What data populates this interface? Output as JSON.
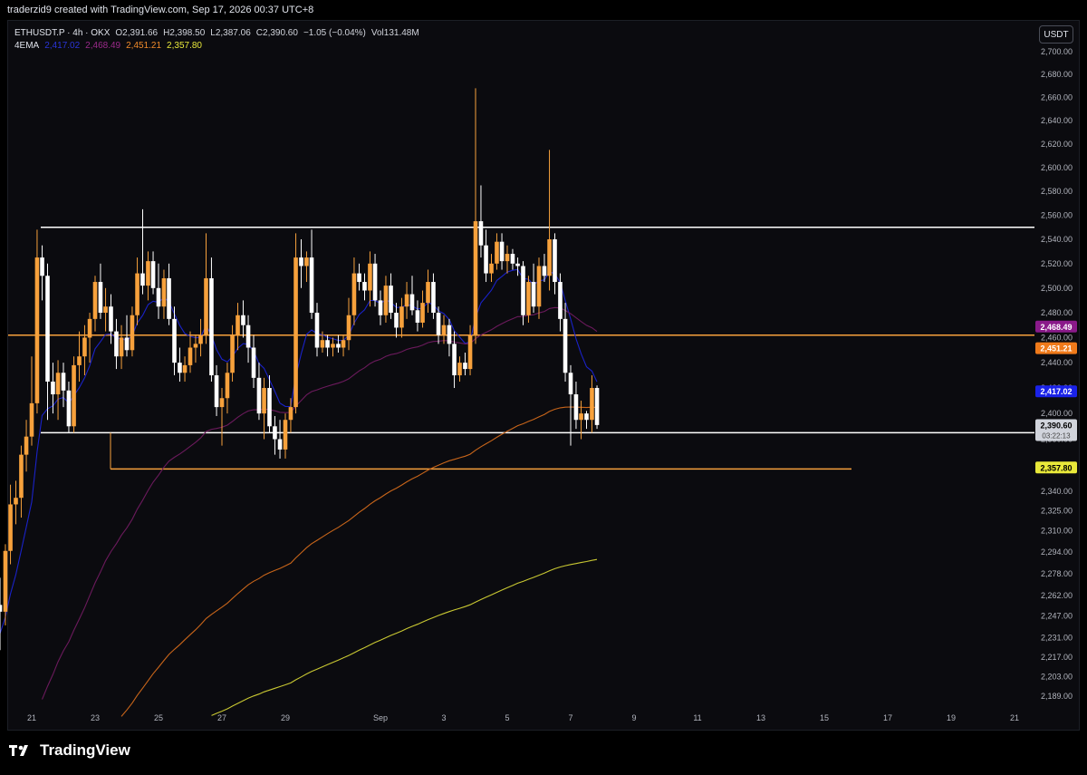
{
  "header": {
    "attribution": "traderzid9 created with TradingView.com, Sep 17, 2026 00:37 UTC+8"
  },
  "legend": {
    "symbol": "ETHUSDT.P · 4h · OKX",
    "open": "O2,391.66",
    "high": "H2,398.50",
    "low": "L2,387.06",
    "close": "C2,390.60",
    "change": "−1.05 (−0.04%)",
    "volume": "Vol131.48M",
    "ema_name": "4EMA",
    "ema_values": [
      "2,417.02",
      "2,468.49",
      "2,451.21",
      "2,357.80"
    ]
  },
  "currency_button": "USDT",
  "footer": {
    "logo_text": "TradingView"
  },
  "colors": {
    "bull": "#f7a13c",
    "bear": "#ffffff",
    "ema1": "#1a22c8",
    "ema2": "#6b1a5c",
    "ema3": "#c8651a",
    "ema4": "#c9c832",
    "price_label_bg": "#d1d4dc",
    "countdown": "03:22:13"
  },
  "chart_data": {
    "type": "candlestick",
    "title": "ETHUSDT.P · 4h · OKX",
    "x_ticks": [
      {
        "label": "21",
        "x": 21
      },
      {
        "label": "23",
        "x": 23
      },
      {
        "label": "25",
        "x": 25
      },
      {
        "label": "27",
        "x": 27
      },
      {
        "label": "29",
        "x": 29
      },
      {
        "label": "Sep",
        "x": 32
      },
      {
        "label": "3",
        "x": 34
      },
      {
        "label": "5",
        "x": 36
      },
      {
        "label": "7",
        "x": 38
      },
      {
        "label": "9",
        "x": 40
      },
      {
        "label": "11",
        "x": 42
      },
      {
        "label": "13",
        "x": 44
      },
      {
        "label": "15",
        "x": 46
      },
      {
        "label": "17",
        "x": 48
      },
      {
        "label": "19",
        "x": 50
      },
      {
        "label": "21",
        "x": 52
      }
    ],
    "x_label_note": "day-of-month ticks Aug 21 – Sep 21",
    "y_ticks": [
      2700.0,
      2680.0,
      2660.0,
      2640.0,
      2620.0,
      2600.0,
      2580.0,
      2560.0,
      2540.0,
      2520.0,
      2500.0,
      2480.0,
      2460.0,
      2440.0,
      2420.0,
      2400.0,
      2380.0,
      2360.0,
      2340.0,
      2325.0,
      2310.0,
      2294.0,
      2278.0,
      2262.0,
      2247.0,
      2231.0,
      2217.0,
      2203.0,
      2189.0
    ],
    "y_tick_labels": [
      "2,700.00",
      "2,680.00",
      "2,660.00",
      "2,640.00",
      "2,620.00",
      "2,600.00",
      "2,580.00",
      "2,560.00",
      "2,540.00",
      "2,520.00",
      "2,500.00",
      "2,480.00",
      "2,460.00",
      "2,440.00",
      "2,420.00",
      "2,400.00",
      "2,380.00",
      "2,360.00",
      "2,340.00",
      "2,325.00",
      "2,310.00",
      "2,294.00",
      "2,278.00",
      "2,262.00",
      "2,247.00",
      "2,231.00",
      "2,217.00",
      "2,203.00",
      "2,189.00"
    ],
    "y_scale": "log",
    "candles": [
      {
        "t": 20.0,
        "o": 2255,
        "h": 2275,
        "l": 2222,
        "c": 2250
      },
      {
        "t": 20.17,
        "o": 2250,
        "h": 2300,
        "l": 2240,
        "c": 2295
      },
      {
        "t": 20.33,
        "o": 2295,
        "h": 2345,
        "l": 2285,
        "c": 2330
      },
      {
        "t": 20.5,
        "o": 2330,
        "h": 2348,
        "l": 2315,
        "c": 2335
      },
      {
        "t": 20.67,
        "o": 2335,
        "h": 2375,
        "l": 2320,
        "c": 2368
      },
      {
        "t": 20.83,
        "o": 2368,
        "h": 2395,
        "l": 2355,
        "c": 2382
      },
      {
        "t": 21.0,
        "o": 2382,
        "h": 2445,
        "l": 2375,
        "c": 2408
      },
      {
        "t": 21.17,
        "o": 2408,
        "h": 2548,
        "l": 2400,
        "c": 2525
      },
      {
        "t": 21.33,
        "o": 2525,
        "h": 2535,
        "l": 2490,
        "c": 2510
      },
      {
        "t": 21.5,
        "o": 2510,
        "h": 2520,
        "l": 2395,
        "c": 2425
      },
      {
        "t": 21.67,
        "o": 2425,
        "h": 2440,
        "l": 2400,
        "c": 2415
      },
      {
        "t": 21.83,
        "o": 2415,
        "h": 2442,
        "l": 2395,
        "c": 2432
      },
      {
        "t": 22.0,
        "o": 2432,
        "h": 2440,
        "l": 2405,
        "c": 2418
      },
      {
        "t": 22.17,
        "o": 2418,
        "h": 2425,
        "l": 2385,
        "c": 2390
      },
      {
        "t": 22.33,
        "o": 2390,
        "h": 2445,
        "l": 2385,
        "c": 2438
      },
      {
        "t": 22.5,
        "o": 2438,
        "h": 2465,
        "l": 2425,
        "c": 2445
      },
      {
        "t": 22.67,
        "o": 2445,
        "h": 2470,
        "l": 2430,
        "c": 2460
      },
      {
        "t": 22.83,
        "o": 2460,
        "h": 2480,
        "l": 2440,
        "c": 2475
      },
      {
        "t": 23.0,
        "o": 2475,
        "h": 2510,
        "l": 2465,
        "c": 2505
      },
      {
        "t": 23.17,
        "o": 2505,
        "h": 2520,
        "l": 2475,
        "c": 2480
      },
      {
        "t": 23.33,
        "o": 2480,
        "h": 2500,
        "l": 2465,
        "c": 2485
      },
      {
        "t": 23.5,
        "o": 2485,
        "h": 2495,
        "l": 2455,
        "c": 2465
      },
      {
        "t": 23.67,
        "o": 2465,
        "h": 2475,
        "l": 2435,
        "c": 2445
      },
      {
        "t": 23.83,
        "o": 2445,
        "h": 2470,
        "l": 2435,
        "c": 2460
      },
      {
        "t": 24.0,
        "o": 2460,
        "h": 2478,
        "l": 2445,
        "c": 2450
      },
      {
        "t": 24.17,
        "o": 2450,
        "h": 2485,
        "l": 2445,
        "c": 2478
      },
      {
        "t": 24.33,
        "o": 2478,
        "h": 2525,
        "l": 2470,
        "c": 2512
      },
      {
        "t": 24.5,
        "o": 2512,
        "h": 2565,
        "l": 2495,
        "c": 2502
      },
      {
        "t": 24.67,
        "o": 2502,
        "h": 2530,
        "l": 2490,
        "c": 2522
      },
      {
        "t": 24.83,
        "o": 2522,
        "h": 2530,
        "l": 2495,
        "c": 2500
      },
      {
        "t": 25.0,
        "o": 2500,
        "h": 2520,
        "l": 2475,
        "c": 2485
      },
      {
        "t": 25.17,
        "o": 2485,
        "h": 2515,
        "l": 2475,
        "c": 2508
      },
      {
        "t": 25.33,
        "o": 2508,
        "h": 2520,
        "l": 2470,
        "c": 2475
      },
      {
        "t": 25.5,
        "o": 2475,
        "h": 2485,
        "l": 2430,
        "c": 2440
      },
      {
        "t": 25.67,
        "o": 2440,
        "h": 2452,
        "l": 2425,
        "c": 2432
      },
      {
        "t": 25.83,
        "o": 2432,
        "h": 2445,
        "l": 2425,
        "c": 2438
      },
      {
        "t": 26.0,
        "o": 2438,
        "h": 2465,
        "l": 2432,
        "c": 2452
      },
      {
        "t": 26.17,
        "o": 2452,
        "h": 2462,
        "l": 2440,
        "c": 2455
      },
      {
        "t": 26.33,
        "o": 2455,
        "h": 2475,
        "l": 2445,
        "c": 2462
      },
      {
        "t": 26.5,
        "o": 2462,
        "h": 2545,
        "l": 2455,
        "c": 2508
      },
      {
        "t": 26.67,
        "o": 2508,
        "h": 2525,
        "l": 2425,
        "c": 2430
      },
      {
        "t": 26.83,
        "o": 2430,
        "h": 2438,
        "l": 2398,
        "c": 2405
      },
      {
        "t": 27.0,
        "o": 2405,
        "h": 2420,
        "l": 2375,
        "c": 2412
      },
      {
        "t": 27.17,
        "o": 2412,
        "h": 2440,
        "l": 2400,
        "c": 2432
      },
      {
        "t": 27.33,
        "o": 2432,
        "h": 2470,
        "l": 2425,
        "c": 2462
      },
      {
        "t": 27.5,
        "o": 2462,
        "h": 2488,
        "l": 2450,
        "c": 2478
      },
      {
        "t": 27.67,
        "o": 2478,
        "h": 2490,
        "l": 2460,
        "c": 2470
      },
      {
        "t": 27.83,
        "o": 2470,
        "h": 2478,
        "l": 2440,
        "c": 2452
      },
      {
        "t": 28.0,
        "o": 2452,
        "h": 2462,
        "l": 2420,
        "c": 2428
      },
      {
        "t": 28.17,
        "o": 2428,
        "h": 2440,
        "l": 2395,
        "c": 2400
      },
      {
        "t": 28.33,
        "o": 2400,
        "h": 2428,
        "l": 2380,
        "c": 2420
      },
      {
        "t": 28.5,
        "o": 2420,
        "h": 2430,
        "l": 2385,
        "c": 2390
      },
      {
        "t": 28.67,
        "o": 2390,
        "h": 2398,
        "l": 2368,
        "c": 2380
      },
      {
        "t": 28.83,
        "o": 2380,
        "h": 2395,
        "l": 2365,
        "c": 2372
      },
      {
        "t": 29.0,
        "o": 2372,
        "h": 2400,
        "l": 2365,
        "c": 2395
      },
      {
        "t": 29.17,
        "o": 2395,
        "h": 2412,
        "l": 2385,
        "c": 2405
      },
      {
        "t": 29.33,
        "o": 2405,
        "h": 2545,
        "l": 2400,
        "c": 2525
      },
      {
        "t": 29.5,
        "o": 2525,
        "h": 2540,
        "l": 2500,
        "c": 2518
      },
      {
        "t": 29.67,
        "o": 2518,
        "h": 2530,
        "l": 2505,
        "c": 2525
      },
      {
        "t": 29.83,
        "o": 2525,
        "h": 2548,
        "l": 2475,
        "c": 2480
      },
      {
        "t": 30.0,
        "o": 2480,
        "h": 2488,
        "l": 2445,
        "c": 2452
      },
      {
        "t": 30.17,
        "o": 2452,
        "h": 2465,
        "l": 2448,
        "c": 2458
      },
      {
        "t": 30.33,
        "o": 2458,
        "h": 2462,
        "l": 2445,
        "c": 2452
      },
      {
        "t": 30.5,
        "o": 2452,
        "h": 2460,
        "l": 2445,
        "c": 2455
      },
      {
        "t": 30.67,
        "o": 2455,
        "h": 2462,
        "l": 2448,
        "c": 2452
      },
      {
        "t": 30.83,
        "o": 2452,
        "h": 2462,
        "l": 2445,
        "c": 2458
      },
      {
        "t": 31.0,
        "o": 2458,
        "h": 2492,
        "l": 2450,
        "c": 2478
      },
      {
        "t": 31.17,
        "o": 2478,
        "h": 2525,
        "l": 2470,
        "c": 2512
      },
      {
        "t": 31.33,
        "o": 2512,
        "h": 2520,
        "l": 2498,
        "c": 2505
      },
      {
        "t": 31.5,
        "o": 2505,
        "h": 2512,
        "l": 2490,
        "c": 2498
      },
      {
        "t": 31.67,
        "o": 2498,
        "h": 2530,
        "l": 2485,
        "c": 2520
      },
      {
        "t": 31.83,
        "o": 2520,
        "h": 2528,
        "l": 2485,
        "c": 2490
      },
      {
        "t": 32.0,
        "o": 2490,
        "h": 2498,
        "l": 2470,
        "c": 2478
      },
      {
        "t": 32.17,
        "o": 2478,
        "h": 2510,
        "l": 2472,
        "c": 2502
      },
      {
        "t": 32.33,
        "o": 2502,
        "h": 2512,
        "l": 2475,
        "c": 2480
      },
      {
        "t": 32.5,
        "o": 2480,
        "h": 2488,
        "l": 2460,
        "c": 2468
      },
      {
        "t": 32.67,
        "o": 2468,
        "h": 2492,
        "l": 2460,
        "c": 2485
      },
      {
        "t": 32.83,
        "o": 2485,
        "h": 2505,
        "l": 2475,
        "c": 2495
      },
      {
        "t": 33.0,
        "o": 2495,
        "h": 2510,
        "l": 2478,
        "c": 2482
      },
      {
        "t": 33.17,
        "o": 2482,
        "h": 2490,
        "l": 2465,
        "c": 2472
      },
      {
        "t": 33.33,
        "o": 2472,
        "h": 2498,
        "l": 2468,
        "c": 2488
      },
      {
        "t": 33.5,
        "o": 2488,
        "h": 2515,
        "l": 2480,
        "c": 2505
      },
      {
        "t": 33.67,
        "o": 2505,
        "h": 2512,
        "l": 2475,
        "c": 2480
      },
      {
        "t": 33.83,
        "o": 2480,
        "h": 2485,
        "l": 2455,
        "c": 2462
      },
      {
        "t": 34.0,
        "o": 2462,
        "h": 2478,
        "l": 2455,
        "c": 2470
      },
      {
        "t": 34.17,
        "o": 2470,
        "h": 2475,
        "l": 2445,
        "c": 2455
      },
      {
        "t": 34.33,
        "o": 2455,
        "h": 2465,
        "l": 2420,
        "c": 2430
      },
      {
        "t": 34.5,
        "o": 2430,
        "h": 2445,
        "l": 2425,
        "c": 2440
      },
      {
        "t": 34.67,
        "o": 2440,
        "h": 2448,
        "l": 2430,
        "c": 2435
      },
      {
        "t": 34.83,
        "o": 2435,
        "h": 2470,
        "l": 2430,
        "c": 2462
      },
      {
        "t": 35.0,
        "o": 2462,
        "h": 2668,
        "l": 2455,
        "c": 2555
      },
      {
        "t": 35.17,
        "o": 2555,
        "h": 2585,
        "l": 2525,
        "c": 2535
      },
      {
        "t": 35.33,
        "o": 2535,
        "h": 2548,
        "l": 2505,
        "c": 2512
      },
      {
        "t": 35.5,
        "o": 2512,
        "h": 2528,
        "l": 2505,
        "c": 2520
      },
      {
        "t": 35.67,
        "o": 2520,
        "h": 2545,
        "l": 2515,
        "c": 2538
      },
      {
        "t": 35.83,
        "o": 2538,
        "h": 2545,
        "l": 2515,
        "c": 2522
      },
      {
        "t": 36.0,
        "o": 2522,
        "h": 2535,
        "l": 2512,
        "c": 2528
      },
      {
        "t": 36.17,
        "o": 2528,
        "h": 2532,
        "l": 2515,
        "c": 2520
      },
      {
        "t": 36.33,
        "o": 2520,
        "h": 2525,
        "l": 2510,
        "c": 2518
      },
      {
        "t": 36.5,
        "o": 2518,
        "h": 2522,
        "l": 2470,
        "c": 2478
      },
      {
        "t": 36.67,
        "o": 2478,
        "h": 2510,
        "l": 2472,
        "c": 2505
      },
      {
        "t": 36.83,
        "o": 2505,
        "h": 2520,
        "l": 2480,
        "c": 2485
      },
      {
        "t": 37.0,
        "o": 2485,
        "h": 2525,
        "l": 2475,
        "c": 2518
      },
      {
        "t": 37.17,
        "o": 2518,
        "h": 2528,
        "l": 2505,
        "c": 2510
      },
      {
        "t": 37.33,
        "o": 2510,
        "h": 2615,
        "l": 2498,
        "c": 2540
      },
      {
        "t": 37.5,
        "o": 2540,
        "h": 2545,
        "l": 2495,
        "c": 2505
      },
      {
        "t": 37.67,
        "o": 2505,
        "h": 2512,
        "l": 2465,
        "c": 2475
      },
      {
        "t": 37.83,
        "o": 2475,
        "h": 2488,
        "l": 2425,
        "c": 2432
      },
      {
        "t": 38.0,
        "o": 2432,
        "h": 2438,
        "l": 2375,
        "c": 2415
      },
      {
        "t": 38.17,
        "o": 2415,
        "h": 2425,
        "l": 2388,
        "c": 2395
      },
      {
        "t": 38.33,
        "o": 2395,
        "h": 2410,
        "l": 2380,
        "c": 2400
      },
      {
        "t": 38.5,
        "o": 2400,
        "h": 2402,
        "l": 2388,
        "c": 2395
      },
      {
        "t": 38.67,
        "o": 2395,
        "h": 2430,
        "l": 2385,
        "c": 2420
      },
      {
        "t": 38.83,
        "o": 2420,
        "h": 2422,
        "l": 2388,
        "c": 2391
      }
    ],
    "ema_series": [
      {
        "name": "EMA 1",
        "last": 2417.02
      },
      {
        "name": "EMA 2",
        "last": 2468.49
      },
      {
        "name": "EMA 3",
        "last": 2451.21
      },
      {
        "name": "EMA 4",
        "last": 2357.8
      }
    ],
    "horizontal_levels": [
      {
        "price": 2550,
        "color": "#ffffff"
      },
      {
        "price": 2462,
        "color": "#f7a13c"
      },
      {
        "price": 2385,
        "color": "#ffffff"
      },
      {
        "price": 2357,
        "color": "#f7a13c"
      }
    ],
    "price_scale_labels": [
      {
        "value": "2,468.49",
        "price": 2468.49,
        "bg": "#8a1a8a",
        "fg": "#ffffff"
      },
      {
        "value": "2,451.21",
        "price": 2451.21,
        "bg": "#f07a1a",
        "fg": "#ffffff"
      },
      {
        "value": "2,417.02",
        "price": 2417.02,
        "bg": "#1a22e8",
        "fg": "#ffffff"
      },
      {
        "value": "2,390.60",
        "price": 2390.6,
        "bg": "#d1d4dc",
        "fg": "#000000"
      },
      {
        "value": "2,357.80",
        "price": 2357.8,
        "bg": "#e8e83a",
        "fg": "#000000"
      }
    ]
  }
}
